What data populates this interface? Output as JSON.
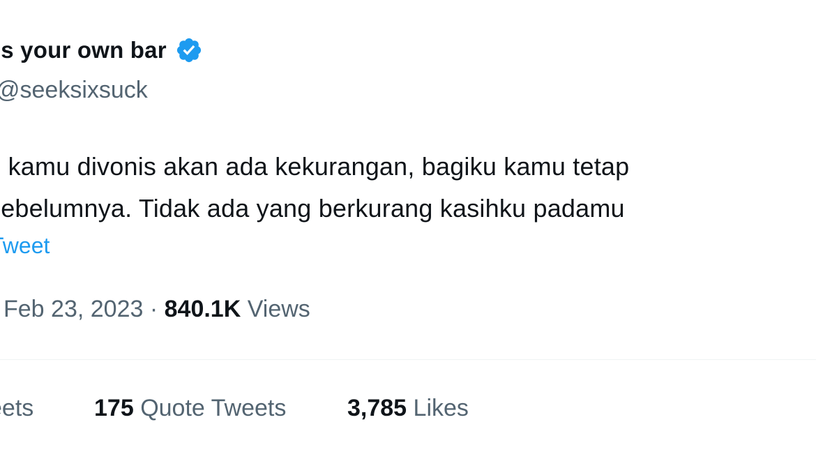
{
  "tweet": {
    "display_name": "t's your own bar",
    "handle": "@seeksixsuck",
    "text_line1": "ti kamu divonis akan ada kekurangan, bagiku kamu tetap",
    "text_line2": "sebelumnya. Tidak ada yang berkurang kasihku padamu",
    "translate_label": "Tweet",
    "date": "Feb 23, 2023",
    "separator": "·",
    "views_count": "840.1K",
    "views_label": "Views"
  },
  "stats": {
    "retweets_label": "eets",
    "quote_count": "175",
    "quote_label": "Quote Tweets",
    "likes_count": "3,785",
    "likes_label": "Likes"
  },
  "colors": {
    "accent": "#1d9bf0",
    "text": "#0f1419",
    "muted": "#536471",
    "divider": "#eff3f4"
  },
  "icons": {
    "verified": "verified-badge-icon"
  }
}
